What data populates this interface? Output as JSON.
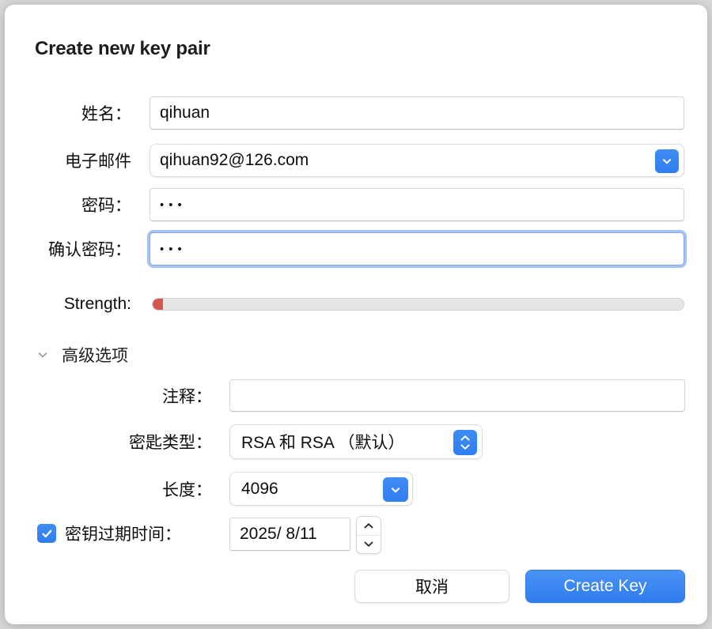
{
  "dialog": {
    "title": "Create new key pair"
  },
  "fields": {
    "name": {
      "label": "姓名：",
      "value": "qihuan"
    },
    "email": {
      "label": "电子邮件",
      "value": "qihuan92@126.com",
      "dropdown_icon": "chevron-down-icon"
    },
    "password": {
      "label": "密码：",
      "value": "•••",
      "masked": true
    },
    "confirm_password": {
      "label": "确认密码：",
      "value": "•••",
      "masked": true,
      "focused": true
    }
  },
  "strength": {
    "label": "Strength:",
    "percent": 2,
    "fill_color": "#d1584f",
    "track_color": "#e6e6e6"
  },
  "advanced": {
    "toggle_label": "高级选项",
    "expanded": true,
    "toggle_icon": "chevron-down-icon",
    "comment": {
      "label": "注释：",
      "value": "",
      "placeholder": ""
    },
    "key_type": {
      "label": "密匙类型：",
      "value": "RSA 和 RSA （默认）",
      "stepper_icon": "chevron-up-down-icon"
    },
    "length": {
      "label": "长度：",
      "value": "4096",
      "dropdown_icon": "chevron-down-icon"
    },
    "expiry": {
      "checkbox_checked": true,
      "checkbox_icon": "checkmark-icon",
      "label": "密钥过期时间：",
      "value": "2025/  8/11",
      "stepper_icon": "stepper-up-down-icon"
    }
  },
  "footer": {
    "cancel_label": "取消",
    "create_label": "Create Key"
  },
  "colors": {
    "accent": "#2f7eef",
    "focus_ring": "#7fa8e8",
    "danger": "#d1584f"
  }
}
